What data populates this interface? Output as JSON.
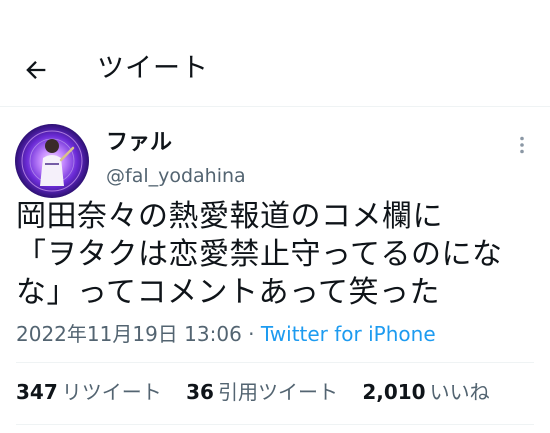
{
  "header": {
    "title": "ツイート"
  },
  "author": {
    "display_name": "ファル",
    "handle": "@fal_yodahina"
  },
  "tweet": {
    "lines": [
      "岡田奈々の熱愛報道のコメ欄に",
      "「ヲタクは恋愛禁止守ってるのにな",
      "な」ってコメントあって笑った"
    ],
    "timestamp": "2022年11月19日 13:06",
    "separator": "·",
    "source": "Twitter for iPhone"
  },
  "stats": {
    "retweets": {
      "count": "347",
      "label": "リツイート"
    },
    "quotes": {
      "count": "36",
      "label": "引用ツイート"
    },
    "likes": {
      "count": "2,010",
      "label": "いいね"
    }
  },
  "colors": {
    "accent": "#1d9bf0",
    "secondary_text": "#536471",
    "divider": "#eff3f4"
  }
}
